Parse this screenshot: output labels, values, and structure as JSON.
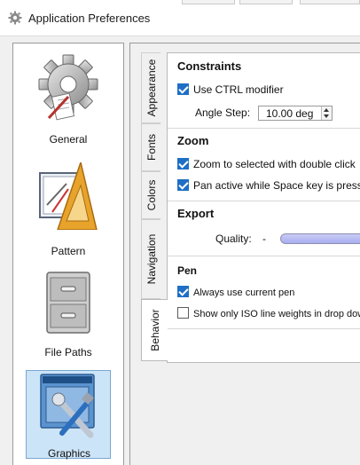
{
  "window": {
    "title": "Application Preferences"
  },
  "pages": [
    {
      "label": "General",
      "icon": "gear-icon"
    },
    {
      "label": "Pattern",
      "icon": "drawing-tools-icon"
    },
    {
      "label": "File Paths",
      "icon": "file-cabinet-icon"
    },
    {
      "label": "Graphics",
      "icon": "window-tools-icon",
      "selected": true
    }
  ],
  "tabs": [
    "Appearance",
    "Fonts",
    "Colors",
    "Navigation",
    "Behavior"
  ],
  "active_tab": "Behavior",
  "constraints": {
    "title": "Constraints",
    "ctrl_label": "Use CTRL modifier",
    "ctrl_checked": true,
    "angle_label": "Angle Step:",
    "angle_value": "10.00 deg"
  },
  "zoom": {
    "title": "Zoom",
    "zoom_label": "Zoom to selected with double click",
    "zoom_checked": true,
    "pan_label": "Pan active while Space key is pressed",
    "pan_checked": true
  },
  "export": {
    "title": "Export",
    "quality_label": "Quality:",
    "quality_min": "-"
  },
  "pen": {
    "title": "Pen",
    "current_label": "Always use current pen",
    "current_checked": true,
    "iso_label": "Show only ISO line weights in drop down",
    "iso_checked": false
  },
  "colors": {
    "accent": "#1f6fc5",
    "selection": "#cce4f7",
    "slider": "#a9aeef"
  }
}
